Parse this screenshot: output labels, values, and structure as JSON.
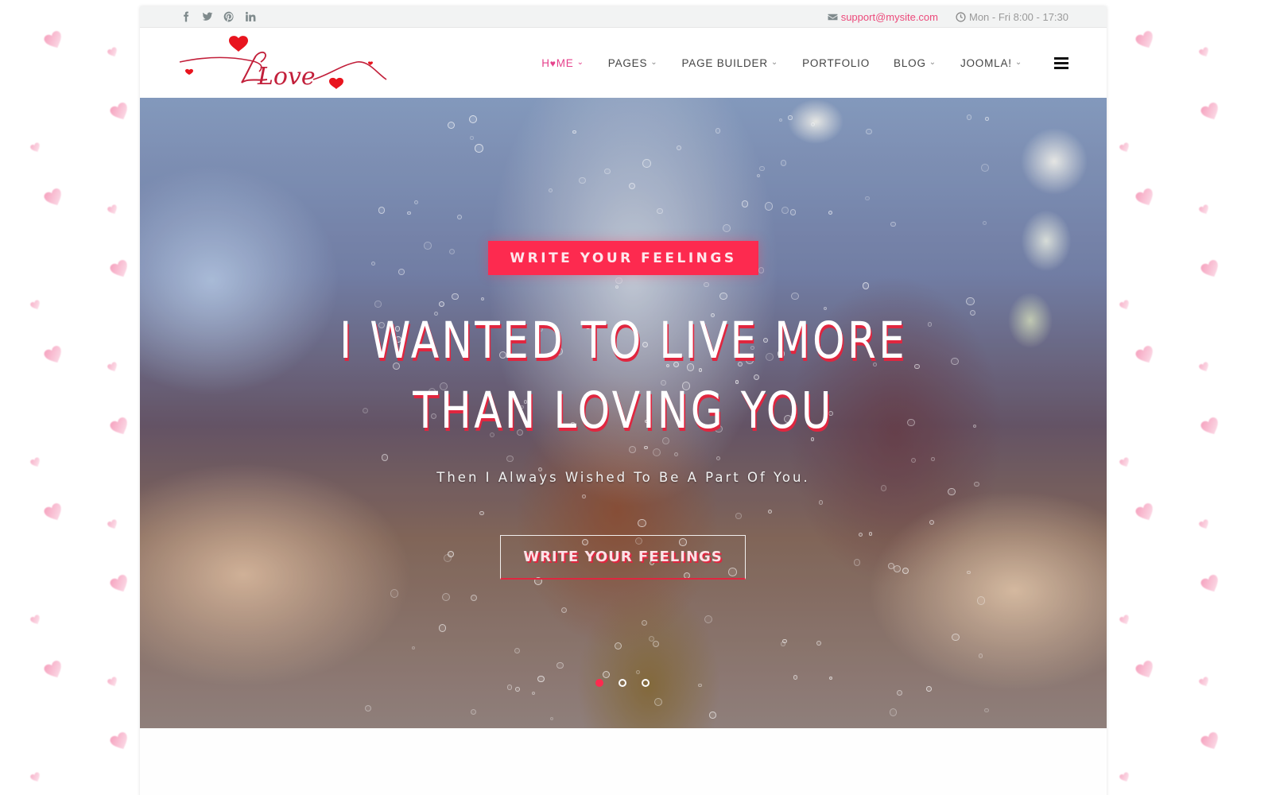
{
  "topbar": {
    "social": [
      {
        "name": "facebook",
        "icon": "facebook-icon"
      },
      {
        "name": "twitter",
        "icon": "twitter-icon"
      },
      {
        "name": "pinterest",
        "icon": "pinterest-icon"
      },
      {
        "name": "linkedin",
        "icon": "linkedin-icon"
      }
    ],
    "email": "support@mysite.com",
    "hours": "Mon - Fri 8:00 - 17:30"
  },
  "header": {
    "logo_text": "Love",
    "nav": [
      {
        "label_pre": "H",
        "label_post": "ME",
        "heart": "♥",
        "has_dropdown": true,
        "active": true
      },
      {
        "label": "PAGES",
        "has_dropdown": true
      },
      {
        "label": "PAGE BUILDER",
        "has_dropdown": true
      },
      {
        "label": "PORTFOLIO",
        "has_dropdown": false
      },
      {
        "label": "BLOG",
        "has_dropdown": true
      },
      {
        "label": "JOOMLA!",
        "has_dropdown": true
      }
    ],
    "chevron": "⌄"
  },
  "hero": {
    "tag_button": "WRITE YOUR FEELINGS",
    "title": "I WANTED TO LIVE MORE THAN LOVING YOU",
    "subtitle": "Then I Always Wished To Be A Part Of You.",
    "cta_button": "WRITE YOUR FEELINGS",
    "slides": 3,
    "active_slide": 1
  },
  "colors": {
    "accent": "#fd2a4f",
    "nav_active": "#e5418b",
    "email": "#ec4a7b",
    "topbar_bg": "#f2f3f3"
  }
}
